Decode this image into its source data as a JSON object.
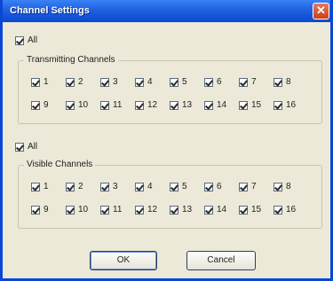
{
  "window": {
    "title": "Channel Settings",
    "close_glyph": "✕"
  },
  "transmit": {
    "all_label": "All",
    "group_title": "Transmitting Channels",
    "channels": [
      {
        "label": "1",
        "checked": true
      },
      {
        "label": "2",
        "checked": true
      },
      {
        "label": "3",
        "checked": true
      },
      {
        "label": "4",
        "checked": true
      },
      {
        "label": "5",
        "checked": true
      },
      {
        "label": "6",
        "checked": true
      },
      {
        "label": "7",
        "checked": true
      },
      {
        "label": "8",
        "checked": true
      },
      {
        "label": "9",
        "checked": true
      },
      {
        "label": "10",
        "checked": true
      },
      {
        "label": "11",
        "checked": true
      },
      {
        "label": "12",
        "checked": true
      },
      {
        "label": "13",
        "checked": true
      },
      {
        "label": "14",
        "checked": true
      },
      {
        "label": "15",
        "checked": true
      },
      {
        "label": "16",
        "checked": true
      }
    ]
  },
  "visible": {
    "all_label": "All",
    "group_title": "Visible Channels",
    "channels": [
      {
        "label": "1",
        "checked": true
      },
      {
        "label": "2",
        "checked": true
      },
      {
        "label": "3",
        "checked": true
      },
      {
        "label": "4",
        "checked": true
      },
      {
        "label": "5",
        "checked": true
      },
      {
        "label": "6",
        "checked": true
      },
      {
        "label": "7",
        "checked": true
      },
      {
        "label": "8",
        "checked": true
      },
      {
        "label": "9",
        "checked": true
      },
      {
        "label": "10",
        "checked": true
      },
      {
        "label": "11",
        "checked": true
      },
      {
        "label": "12",
        "checked": true
      },
      {
        "label": "13",
        "checked": true
      },
      {
        "label": "14",
        "checked": true
      },
      {
        "label": "15",
        "checked": true
      },
      {
        "label": "16",
        "checked": true
      }
    ]
  },
  "buttons": {
    "ok": "OK",
    "cancel": "Cancel"
  }
}
